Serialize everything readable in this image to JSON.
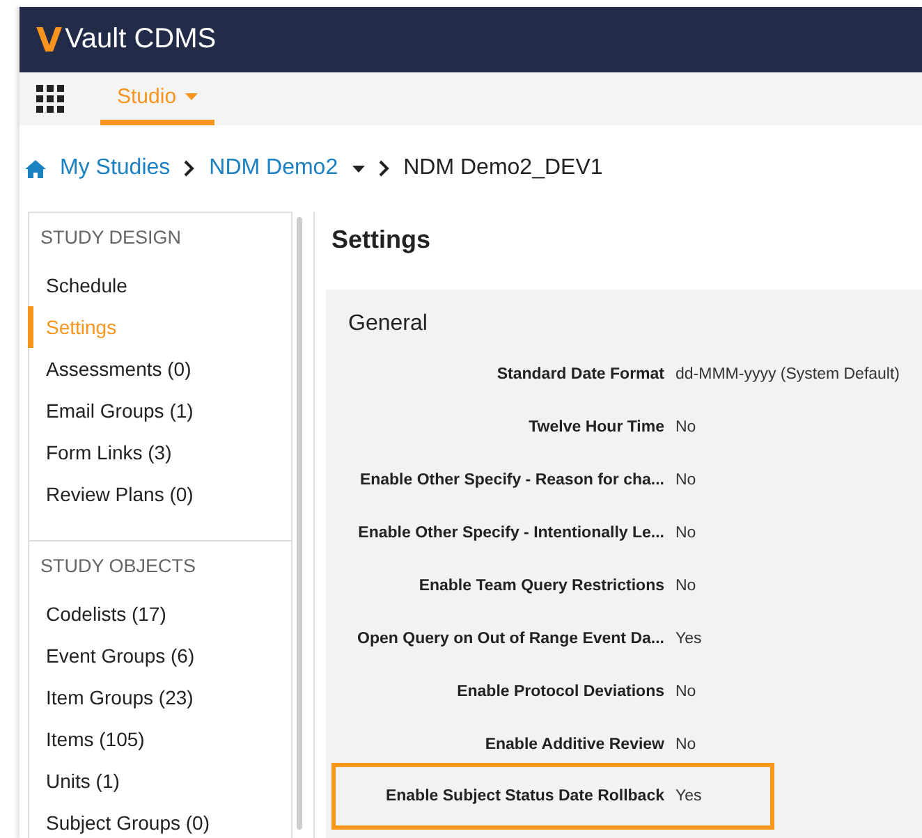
{
  "header": {
    "logo_mark": "V",
    "title": "Vault CDMS"
  },
  "nav": {
    "tabs": [
      {
        "label": "Studio",
        "selected": true
      }
    ]
  },
  "breadcrumb": [
    {
      "label": "My Studies",
      "kind": "home"
    },
    {
      "label": "NDM Demo2",
      "kind": "dropdown"
    },
    {
      "label": "NDM Demo2_DEV1",
      "kind": "current"
    }
  ],
  "sidebar": {
    "sections": [
      {
        "title": "STUDY DESIGN",
        "items": [
          {
            "label": "Schedule",
            "selected": false
          },
          {
            "label": "Settings",
            "selected": true
          },
          {
            "label": "Assessments (0)",
            "selected": false
          },
          {
            "label": "Email Groups (1)",
            "selected": false
          },
          {
            "label": "Form Links (3)",
            "selected": false
          },
          {
            "label": "Review Plans (0)",
            "selected": false
          }
        ]
      },
      {
        "title": "STUDY OBJECTS",
        "items": [
          {
            "label": "Codelists (17)",
            "selected": false
          },
          {
            "label": "Event Groups (6)",
            "selected": false
          },
          {
            "label": "Item Groups (23)",
            "selected": false
          },
          {
            "label": "Items (105)",
            "selected": false
          },
          {
            "label": "Units (1)",
            "selected": false
          },
          {
            "label": "Subject Groups (0)",
            "selected": false
          }
        ]
      }
    ]
  },
  "page_title": "Settings",
  "panel": {
    "title": "General",
    "rows": [
      {
        "label": "Standard Date Format",
        "value": "dd-MMM-yyyy (System Default)",
        "highlighted": false
      },
      {
        "label": "Twelve Hour Time",
        "value": "No",
        "highlighted": false
      },
      {
        "label": "Enable Other Specify - Reason for cha...",
        "value": "No",
        "highlighted": false
      },
      {
        "label": "Enable Other Specify - Intentionally Le...",
        "value": "No",
        "highlighted": false
      },
      {
        "label": "Enable Team Query Restrictions",
        "value": "No",
        "highlighted": false
      },
      {
        "label": "Open Query on Out of Range Event Da...",
        "value": "Yes",
        "highlighted": false
      },
      {
        "label": "Enable Protocol Deviations",
        "value": "No",
        "highlighted": false
      },
      {
        "label": "Enable Additive Review",
        "value": "No",
        "highlighted": false
      },
      {
        "label": "Enable Subject Status Date Rollback",
        "value": "Yes",
        "highlighted": true
      }
    ]
  }
}
